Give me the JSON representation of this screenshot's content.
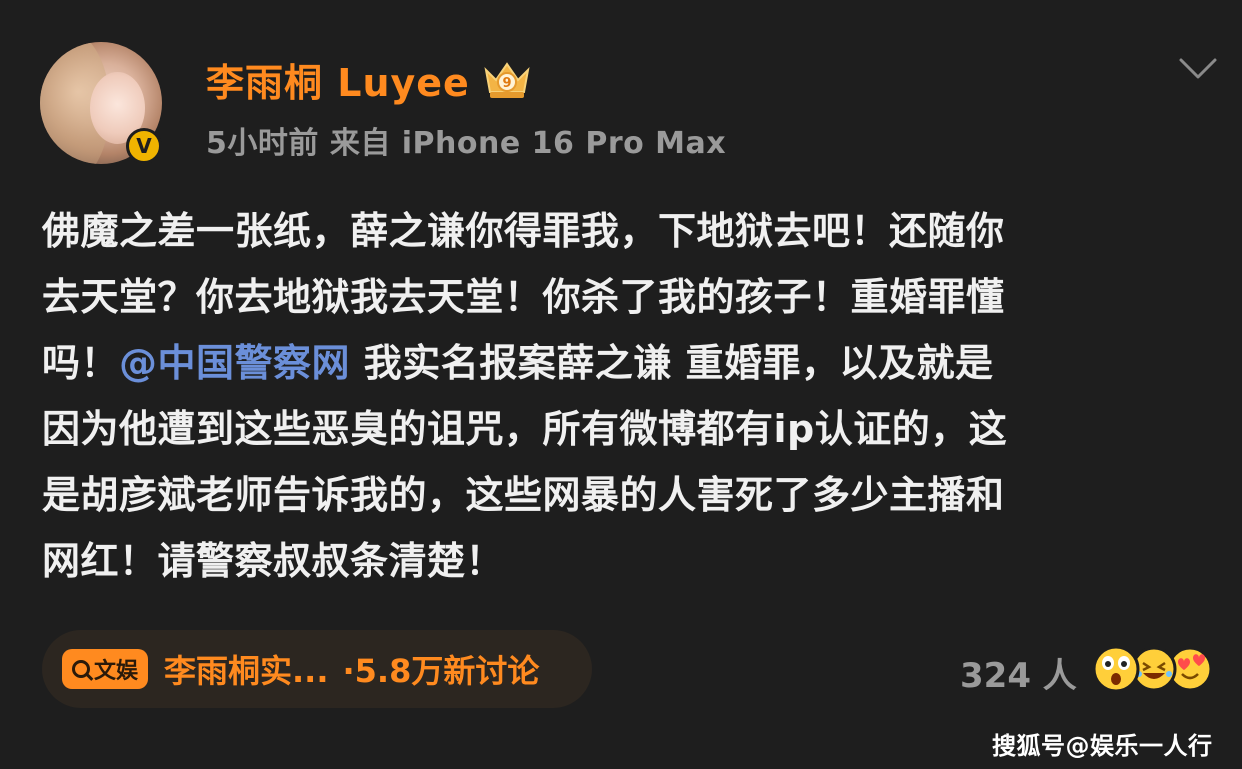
{
  "post": {
    "username": "李雨桐 Luyee",
    "crown_badge_level": "9",
    "verified_mark": "V",
    "meta": "5小时前  来自 iPhone 16 Pro Max",
    "content_lines": [
      {
        "text": "佛魔之差一张纸，薛之谦你得罪我，下地狱去吧！还随你"
      },
      {
        "text": "去天堂？你去地狱我去天堂！你杀了我的孩子！重婚罪懂"
      },
      {
        "pre": "吗！",
        "mention": "@中国警察网",
        "post": " 我实名报案薛之谦 重婚罪，以及就是"
      },
      {
        "text": "因为他遭到这些恶臭的诅咒，所有微博都有ip认证的，这"
      },
      {
        "text": "是胡彦斌老师告诉我的，这些网暴的人害死了多少主播和"
      },
      {
        "text": "网红！请警察叔叔条清楚！"
      }
    ],
    "topic": {
      "badge_label": "文娱",
      "text": "李雨桐实...",
      "count": "·5.8万新讨论"
    },
    "reactions": {
      "count": "324 人",
      "emojis": [
        "surprised-face-icon",
        "laughing-face-icon",
        "heart-face-icon"
      ]
    }
  },
  "watermark": "搜狐号@娱乐一人行",
  "colors": {
    "background": "#1e1e1e",
    "username": "#ff8a1f",
    "meta": "#9a9a9a",
    "content": "#f0f0f0",
    "mention": "#6b8fd9",
    "topic": "#ff8a1f",
    "verified": "#f0b400"
  }
}
